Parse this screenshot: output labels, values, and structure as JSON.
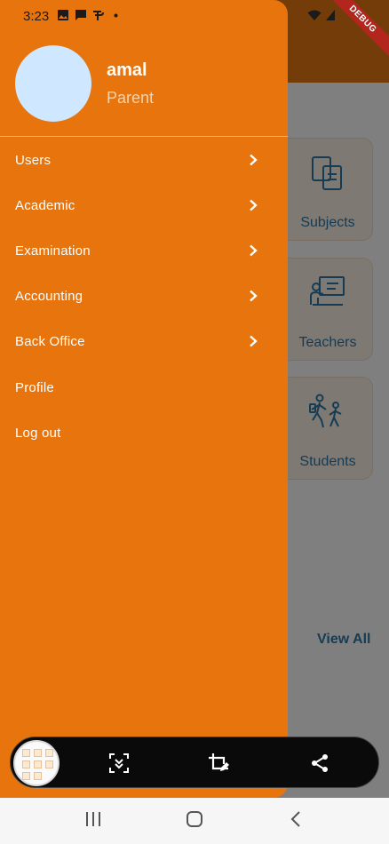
{
  "status_bar": {
    "time": "3:23",
    "debug_banner": "DEBUG",
    "icons": [
      "gallery-icon",
      "message-icon",
      "phonepe-icon",
      "dot-icon",
      "wifi-icon",
      "signal-icon"
    ]
  },
  "drawer": {
    "user": {
      "name": "amal",
      "role": "Parent"
    },
    "menu": [
      {
        "label": "Users",
        "has_submenu": true
      },
      {
        "label": "Academic",
        "has_submenu": true
      },
      {
        "label": "Examination",
        "has_submenu": true
      },
      {
        "label": "Accounting",
        "has_submenu": true
      },
      {
        "label": "Back Office",
        "has_submenu": true
      },
      {
        "label": "Profile",
        "has_submenu": false
      },
      {
        "label": "Log out",
        "has_submenu": false
      }
    ]
  },
  "background": {
    "tiles": [
      {
        "label": "Subjects",
        "icon": "books-icon"
      },
      {
        "label": "Teachers",
        "icon": "teacher-icon"
      },
      {
        "label": "Students",
        "icon": "students-icon"
      }
    ],
    "view_all": "View All"
  },
  "capture_toolbar": {
    "actions": [
      "scroll-capture-icon",
      "crop-edit-icon",
      "share-icon"
    ]
  },
  "nav_bar": {
    "buttons": [
      "recents-icon",
      "home-icon",
      "back-icon"
    ]
  },
  "colors": {
    "drawer": "#e8740d",
    "accent_blue": "#2a79a8",
    "scrim": "rgba(0,0,0,0.5)"
  }
}
